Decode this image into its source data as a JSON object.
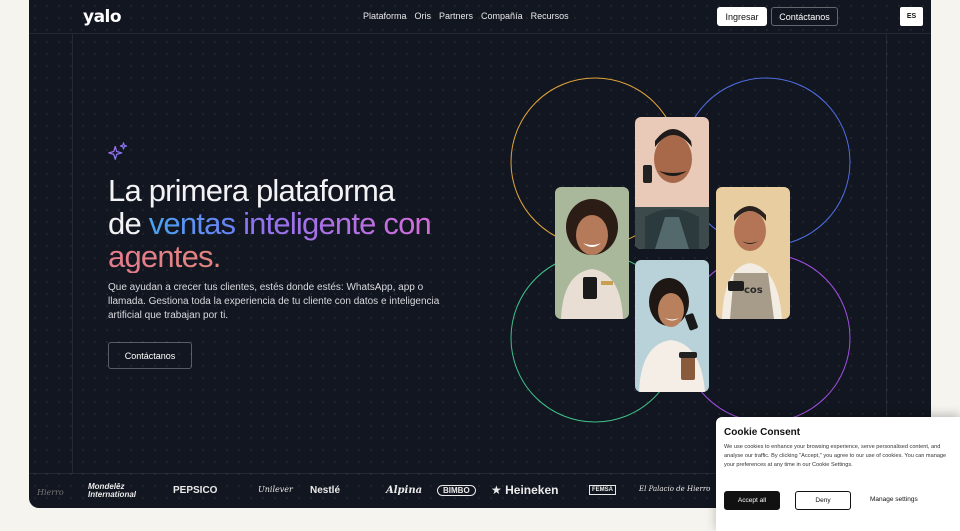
{
  "nav": {
    "logo": "yalo",
    "menu": [
      "Plataforma",
      "Oris",
      "Partners",
      "Compañía",
      "Recursos"
    ],
    "login": "Ingresar",
    "contact": "Contáctanos",
    "lang": "ES"
  },
  "hero": {
    "line1": "La primera plataforma",
    "line2_a": "de ",
    "line2_b": "ventas ",
    "line2_c": "inteligente con",
    "line3": "agentes.",
    "subtext": "Que ayudan a crecer tus clientes, estés donde estés: WhatsApp, app o llamada. Gestiona toda la experiencia de tu cliente con datos e inteligencia artificial que trabajan por ti.",
    "cta": "Contáctanos"
  },
  "logos": [
    "Mondelēz International",
    "PEPSICO",
    "Unilever",
    "Nestlé",
    "Alpina",
    "BIMBO",
    "Heineken",
    "FEMSA",
    "El Palacio de Hierro"
  ],
  "cookie": {
    "title": "Cookie Consent",
    "body": "We use cookies to enhance your browsing experience, serve personalised content, and analyse our traffic. By clicking \"Accept,\" you agree to our use of cookies. You can manage your preferences at any time in our Cookie Settings.",
    "accept": "Accept all",
    "deny": "Deny",
    "manage": "Manage settings"
  },
  "colors": {
    "background": "#121620",
    "page": "#f6f4ee",
    "circle_top_left": "#e0a33a",
    "circle_top_right": "#4f6de0",
    "circle_bottom_left": "#3fc08a",
    "circle_bottom_right": "#a14fe0"
  },
  "icons": [
    "sparkle-icon",
    "star-icon"
  ]
}
